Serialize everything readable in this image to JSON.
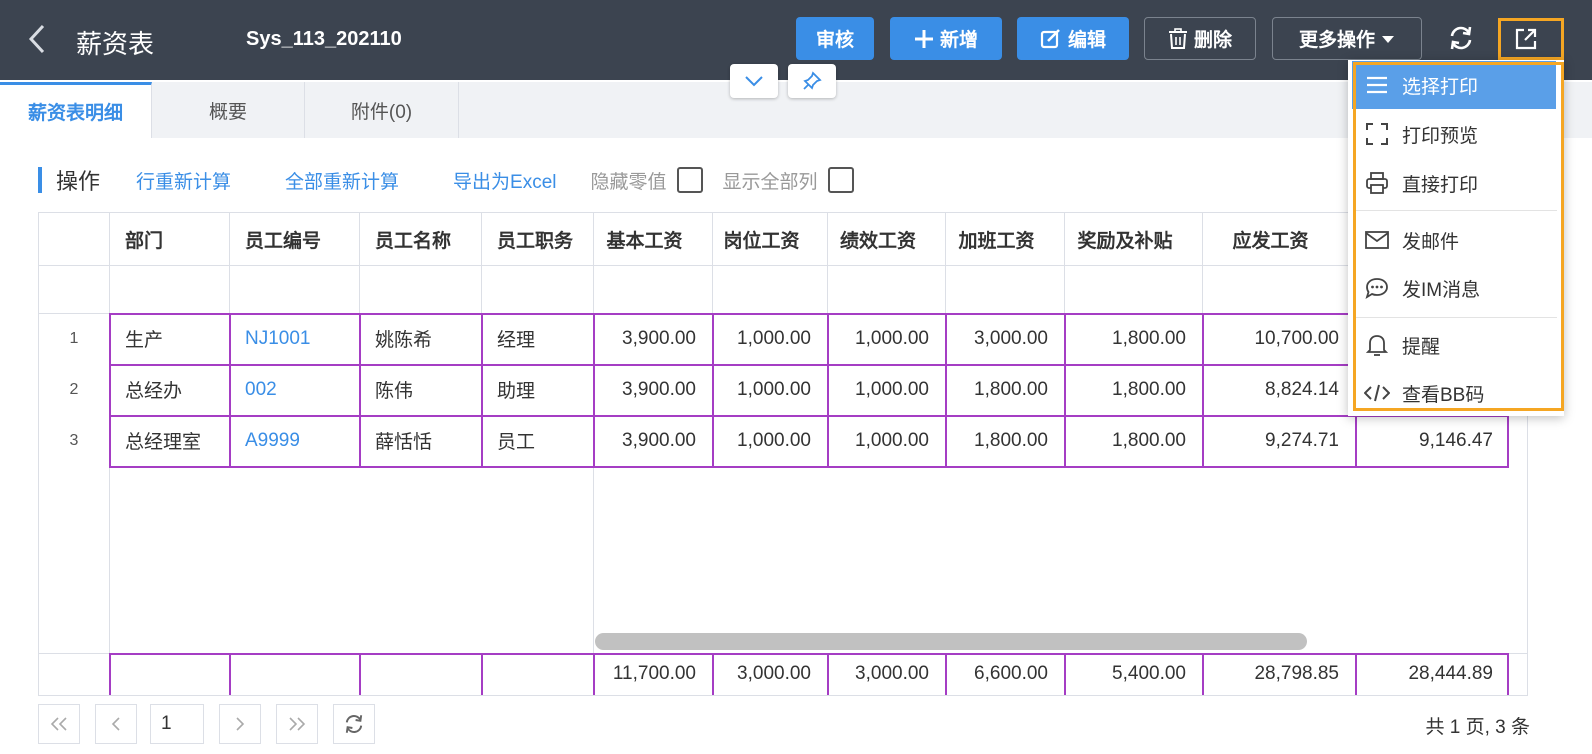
{
  "header": {
    "title": "薪资表",
    "doc_no": "Sys_113_202110",
    "buttons": {
      "audit": "审核",
      "add": "新增",
      "edit": "编辑",
      "delete": "删除",
      "more": "更多操作"
    }
  },
  "tabs": [
    {
      "label": "薪资表明细",
      "active": true
    },
    {
      "label": "概要",
      "active": false
    },
    {
      "label": "附件(0)",
      "active": false
    }
  ],
  "ops": {
    "label": "操作",
    "links": [
      "行重新计算",
      "全部重新计算",
      "导出为Excel"
    ],
    "hide_zero_label": "隐藏零值",
    "show_all_cols_label": "显示全部列",
    "hide_zero_checked": false,
    "show_all_cols_checked": false
  },
  "table": {
    "columns": [
      "部门",
      "员工编号",
      "员工名称",
      "员工职务",
      "基本工资",
      "岗位工资",
      "绩效工资",
      "加班工资",
      "奖励及补贴",
      "应发工资"
    ],
    "rows": [
      {
        "num": "1",
        "dept": "生产",
        "code": "NJ1001",
        "name": "姚陈希",
        "title": "经理",
        "base": "3,900.00",
        "post": "1,000.00",
        "perf": "1,000.00",
        "ot": "3,000.00",
        "bonus": "1,800.00",
        "gross": "10,700.00",
        "extra": ""
      },
      {
        "num": "2",
        "dept": "总经办",
        "code": "002",
        "name": "陈伟",
        "title": "助理",
        "base": "3,900.00",
        "post": "1,000.00",
        "perf": "1,000.00",
        "ot": "1,800.00",
        "bonus": "1,800.00",
        "gross": "8,824.14",
        "extra": ""
      },
      {
        "num": "3",
        "dept": "总经理室",
        "code": "A9999",
        "name": "薛恬恬",
        "title": "员工",
        "base": "3,900.00",
        "post": "1,000.00",
        "perf": "1,000.00",
        "ot": "1,800.00",
        "bonus": "1,800.00",
        "gross": "9,274.71",
        "extra": "9,146.47"
      }
    ],
    "totals": {
      "base": "11,700.00",
      "post": "3,000.00",
      "perf": "3,000.00",
      "ot": "6,600.00",
      "bonus": "5,400.00",
      "gross": "28,798.85",
      "extra": "28,444.89"
    }
  },
  "pager": {
    "page": "1",
    "info": "共 1 页, 3 条"
  },
  "dropdown": {
    "items": [
      {
        "label": "选择打印",
        "icon": "list-icon",
        "active": true
      },
      {
        "label": "打印预览",
        "icon": "fullscreen-icon",
        "active": false
      },
      {
        "label": "直接打印",
        "icon": "printer-icon",
        "active": false
      },
      {
        "label": "发邮件",
        "icon": "mail-icon",
        "active": false
      },
      {
        "label": "发IM消息",
        "icon": "chat-icon",
        "active": false
      },
      {
        "label": "提醒",
        "icon": "bell-icon",
        "active": false
      },
      {
        "label": "查看BB码",
        "icon": "code-icon",
        "active": false
      }
    ]
  },
  "colors": {
    "header_bg": "#3c4450",
    "primary": "#3a8ee6",
    "highlight_border": "#f5a623",
    "row_border": "#a53dc4"
  }
}
